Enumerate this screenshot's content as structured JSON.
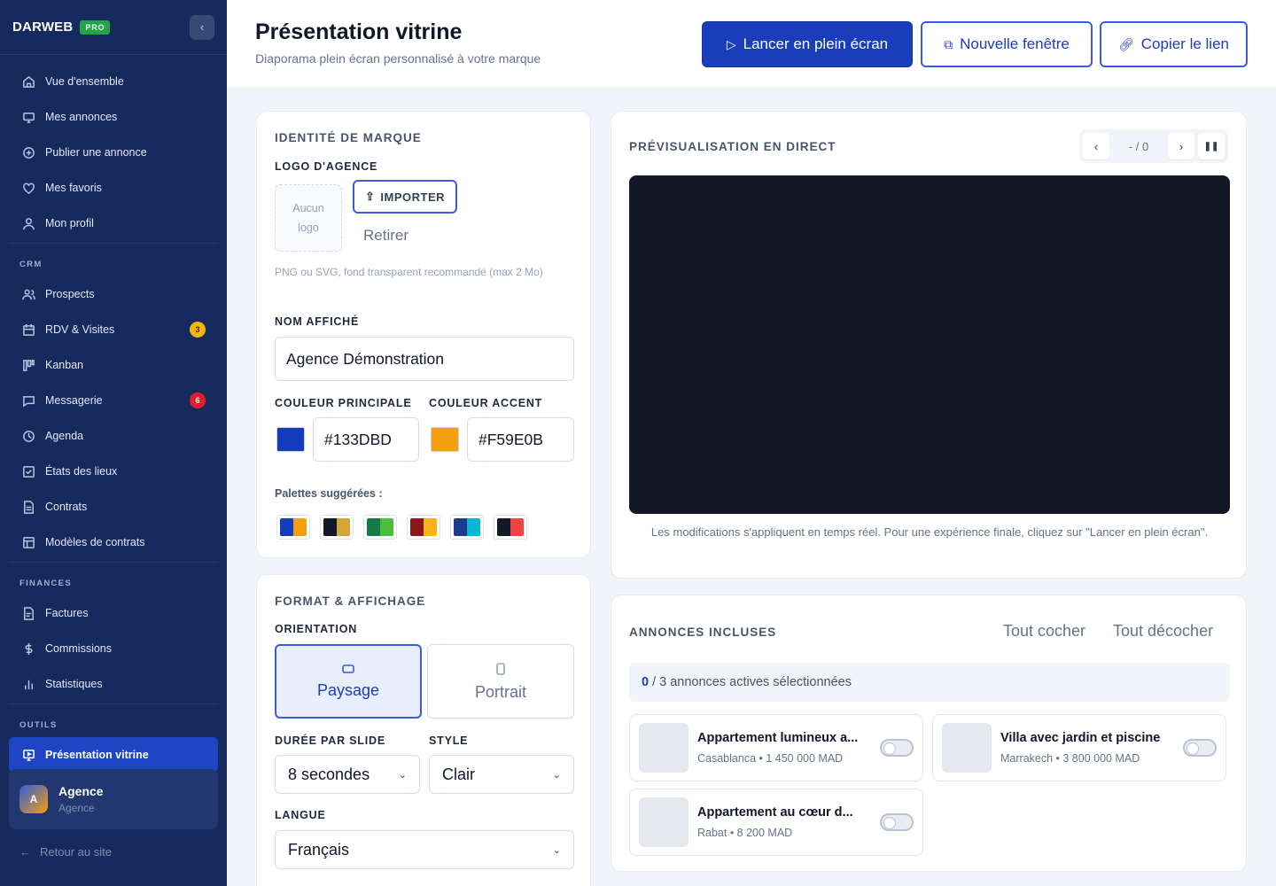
{
  "sidebar": {
    "brand": "DARWEB",
    "badge": "PRO",
    "collapse_icon": "‹",
    "items_main": [
      {
        "label": "Vue d'ensemble",
        "icon": "home-icon"
      },
      {
        "label": "Mes annonces",
        "icon": "monitor-icon"
      },
      {
        "label": "Publier une annonce",
        "icon": "plus-circle-icon"
      },
      {
        "label": "Mes favoris",
        "icon": "heart-icon"
      },
      {
        "label": "Mon profil",
        "icon": "user-icon"
      }
    ],
    "section_crm": "CRM",
    "items_crm": [
      {
        "label": "Prospects",
        "icon": "users-icon",
        "badge": ""
      },
      {
        "label": "RDV & Visites",
        "icon": "calendar-icon",
        "badge": "3"
      },
      {
        "label": "Kanban",
        "icon": "kanban-icon",
        "badge": ""
      },
      {
        "label": "Messagerie",
        "icon": "message-icon",
        "badge": "6"
      },
      {
        "label": "Agenda",
        "icon": "clock-icon",
        "badge": ""
      },
      {
        "label": "États des lieux",
        "icon": "checklist-icon",
        "badge": ""
      },
      {
        "label": "Contrats",
        "icon": "document-icon",
        "badge": ""
      },
      {
        "label": "Modèles de contrats",
        "icon": "template-icon",
        "badge": ""
      }
    ],
    "section_finances": "FINANCES",
    "items_finances": [
      {
        "label": "Factures",
        "icon": "invoice-icon"
      },
      {
        "label": "Commissions",
        "icon": "dollar-icon"
      },
      {
        "label": "Statistiques",
        "icon": "bar-chart-icon"
      }
    ],
    "section_outils": "OUTILS",
    "active_item": "Présentation vitrine",
    "user": {
      "initial": "A",
      "name": "Agence",
      "role": "Agence"
    },
    "back_link": "Retour au site"
  },
  "header": {
    "title": "Présentation vitrine",
    "subtitle": "Diaporama plein écran personnalisé à votre marque",
    "btn_fullscreen": "Lancer en plein écran",
    "btn_new_window": "Nouvelle fenêtre",
    "btn_copy_link": "Copier le lien"
  },
  "brand_identity": {
    "title": "IDENTITÉ DE MARQUE",
    "logo_label": "LOGO D'AGENCE",
    "no_logo_line1": "Aucun",
    "no_logo_line2": "logo",
    "import_btn": "IMPORTER",
    "remove_btn": "Retirer",
    "hint": "PNG ou SVG, fond transparent recommandé (max 2 Mo)",
    "name_label": "NOM AFFICHÉ",
    "name_value": "Agence Démonstration",
    "primary_label": "COULEUR PRINCIPALE",
    "primary_value": "#133DBD",
    "accent_label": "COULEUR ACCENT",
    "accent_value": "#F59E0B",
    "palettes_label": "Palettes suggérées :",
    "palettes": [
      [
        "#133DBD",
        "#F59E0B"
      ],
      [
        "#111827",
        "#D4A537"
      ],
      [
        "#157A46",
        "#4CBF3A"
      ],
      [
        "#8E1515",
        "#F5B31A"
      ],
      [
        "#1E3A8A",
        "#06B6D4"
      ],
      [
        "#111827",
        "#EF4444"
      ]
    ]
  },
  "format": {
    "title": "FORMAT & AFFICHAGE",
    "orientation_label": "ORIENTATION",
    "landscape": "Paysage",
    "portrait": "Portrait",
    "duration_label": "DURÉE PAR SLIDE",
    "duration_value": "8 secondes",
    "style_label": "STYLE",
    "style_value": "Clair",
    "lang_label": "LANGUE",
    "lang_value": "Français"
  },
  "preview": {
    "title": "PRÉVISUALISATION EN DIRECT",
    "counter": "- / 0",
    "note": "Les modifications s'appliquent en temps réel. Pour une expérience finale, cliquez sur \"Lancer en plein écran\"."
  },
  "listings": {
    "title": "ANNONCES INCLUSES",
    "check_all": "Tout cocher",
    "uncheck_all": "Tout décocher",
    "selected_count": "0",
    "selected_text": "/ 3 annonces actives sélectionnées",
    "items": [
      {
        "title": "Appartement lumineux a...",
        "sub": "Casablanca • 1 450 000 MAD",
        "selected": false
      },
      {
        "title": "Villa avec jardin et piscine",
        "sub": "Marrakech • 3 800 000 MAD",
        "selected": false
      },
      {
        "title": "Appartement au cœur d...",
        "sub": "Rabat • 8 200 MAD",
        "selected": false
      }
    ]
  }
}
